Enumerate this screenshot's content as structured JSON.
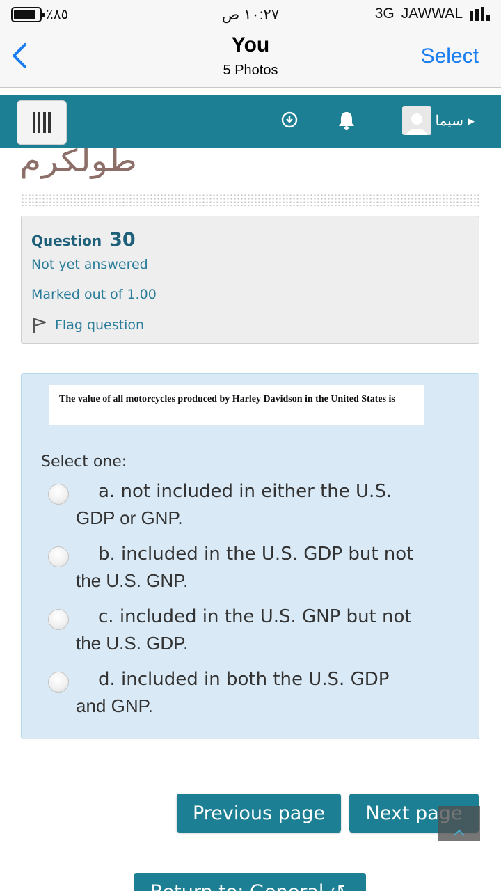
{
  "status_bar": {
    "battery": "٪٨٥",
    "time": "١٠:٢٧ ص",
    "network": "3G",
    "carrier": "JAWWAL"
  },
  "nav": {
    "title": "You",
    "subtitle": "5 Photos",
    "select_label": "Select"
  },
  "header": {
    "user_name": "سيما",
    "accent_color": "#1d7f93"
  },
  "site": {
    "logo_text": "طولكرم"
  },
  "question": {
    "label": "Question",
    "number": "30",
    "state": "Not yet answered",
    "marked": "Marked out of 1.00",
    "flag_label": "Flag question"
  },
  "formulation": {
    "question_text": "The value of all motorcycles produced by Harley Davidson in the United States is",
    "prompt": "Select one:",
    "answers": [
      {
        "line1": "a. not included in either the U.S.",
        "line2": "GDP or GNP."
      },
      {
        "line1": "b. included in the U.S. GDP but not",
        "line2": "the U.S. GNP."
      },
      {
        "line1": "c. included in the U.S. GNP but not",
        "line2": "the U.S. GDP."
      },
      {
        "line1": "d. included in both the U.S. GDP",
        "line2": "and GNP."
      }
    ]
  },
  "buttons": {
    "previous": "Previous page",
    "next": "Next page",
    "return": "Return to: General ↺"
  }
}
